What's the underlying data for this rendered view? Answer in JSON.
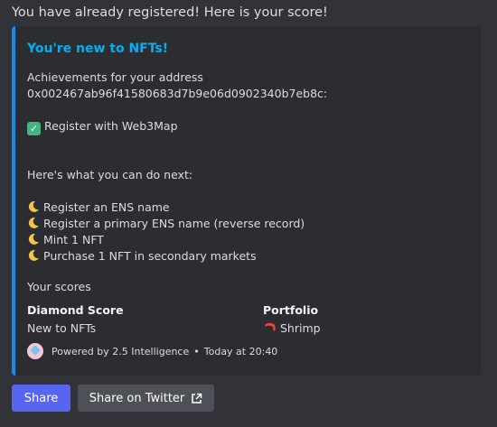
{
  "message": "You have already registered! Here is your score!",
  "embed": {
    "title": "You're new to NFTs!",
    "accent_color": "#1e88e5",
    "achievements_line1": "Achievements for your address",
    "address": "0x002467ab96f41580683d7b9e06d0902340b7eb8c:",
    "done_items": [
      "Register with Web3Map"
    ],
    "next_heading": "Here's what you can do next:",
    "next_items": [
      "Register an ENS name",
      "Register a primary ENS name (reverse record)",
      "Mint 1 NFT",
      "Purchase 1 NFT in secondary markets"
    ],
    "scores_label": "Your scores",
    "fields": [
      {
        "name": "Diamond Score",
        "value": "New to NFTs"
      },
      {
        "name": "Portfolio",
        "value": "Shrimp"
      }
    ],
    "footer": {
      "text": "Powered by 2.5 Intelligence",
      "separator": "•",
      "timestamp": "Today at 20:40"
    }
  },
  "buttons": {
    "share": "Share",
    "share_twitter": "Share on Twitter"
  },
  "icons": {
    "done": "check-mark-icon",
    "todo": "crescent-moon-icon",
    "portfolio": "shrimp-icon",
    "external": "external-link-icon"
  }
}
